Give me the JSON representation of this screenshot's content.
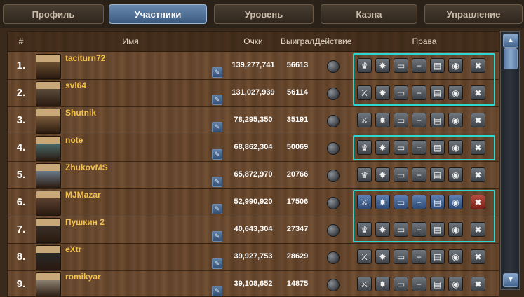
{
  "tabs": [
    {
      "label": "Профиль",
      "active": false
    },
    {
      "label": "Участники",
      "active": true
    },
    {
      "label": "Уровень",
      "active": false
    },
    {
      "label": "Казна",
      "active": false
    },
    {
      "label": "Управление",
      "active": false
    }
  ],
  "table": {
    "headers": {
      "rank": "#",
      "name": "Имя",
      "points": "Очки",
      "won": "Выиграл",
      "action": "Действие",
      "rights": "Права"
    },
    "rows": [
      {
        "rank": "1.",
        "name": "taciturn72",
        "points": "139,277,741",
        "won": "56613",
        "rights": [
          "crown-icon",
          "star-icon",
          "message-icon",
          "plus-icon",
          "map-icon",
          "eye-icon",
          "remove-member-icon"
        ],
        "highlight": true
      },
      {
        "rank": "2.",
        "name": "svl64",
        "points": "131,027,939",
        "won": "56114",
        "rights": [
          "swords-icon",
          "star-icon",
          "message-icon",
          "plus-icon",
          "map-icon",
          "eye-icon",
          "remove-member-icon"
        ],
        "highlight": true
      },
      {
        "rank": "3.",
        "name": "Shutnik",
        "points": "78,295,350",
        "won": "35191",
        "rights": [
          "swords-icon",
          "star-icon",
          "message-icon",
          "plus-icon",
          "map-icon",
          "eye-icon",
          "remove-member-icon"
        ],
        "highlight": false
      },
      {
        "rank": "4.",
        "name": "note",
        "points": "68,862,304",
        "won": "50069",
        "rights": [
          "crown-icon",
          "star-icon",
          "message-icon",
          "plus-icon",
          "map-icon",
          "eye-icon",
          "remove-member-icon"
        ],
        "highlight": true
      },
      {
        "rank": "5.",
        "name": "ZhukovMS",
        "points": "65,872,970",
        "won": "20766",
        "rights": [
          "crown-icon",
          "star-icon",
          "message-icon",
          "plus-icon",
          "map-icon",
          "eye-icon",
          "remove-member-icon"
        ],
        "highlight": false
      },
      {
        "rank": "6.",
        "name": "MJMazar",
        "points": "52,990,920",
        "won": "17506",
        "rights": [
          "swords-icon",
          "star-icon",
          "message-icon",
          "plus-icon",
          "map-icon",
          "eye-icon",
          "remove-member-icon"
        ],
        "highlight": true,
        "disabled_rights": true
      },
      {
        "rank": "7.",
        "name": "Пушкин 2",
        "points": "40,643,304",
        "won": "27347",
        "rights": [
          "crown-icon",
          "star-icon",
          "message-icon",
          "plus-icon",
          "map-icon",
          "eye-icon",
          "remove-member-icon"
        ],
        "highlight": true
      },
      {
        "rank": "8.",
        "name": "eXtr",
        "points": "39,927,753",
        "won": "28629",
        "rights": [
          "swords-icon",
          "star-icon",
          "message-icon",
          "plus-icon",
          "map-icon",
          "eye-icon",
          "remove-member-icon"
        ],
        "highlight": false
      },
      {
        "rank": "9.",
        "name": "romikyar",
        "points": "39,108,652",
        "won": "14875",
        "rights": [
          "swords-icon",
          "star-icon",
          "message-icon",
          "plus-icon",
          "map-icon",
          "eye-icon",
          "remove-member-icon"
        ],
        "highlight": false
      }
    ]
  },
  "colors": {
    "highlight": "#30d6d0",
    "name": "#f2c24a",
    "active_tab": "#4a6a94"
  }
}
